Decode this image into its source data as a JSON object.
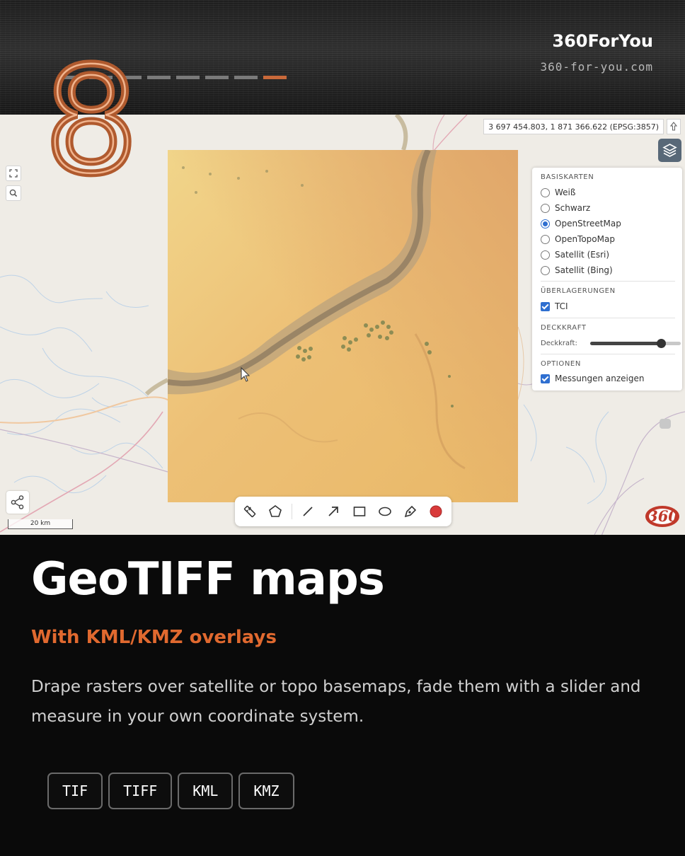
{
  "header": {
    "brand": "360ForYou",
    "url": "360-for-you.com",
    "slide_number": "8",
    "progress": {
      "total": 8,
      "current": 8
    },
    "accent_color": "#c9693a"
  },
  "map": {
    "coordinates": "3 697 454.803, 1 871 366.622 (EPSG:3857)",
    "coord_button_icon": "arrow-up-icon",
    "scale_label": "20 km",
    "layer_panel": {
      "basemaps_title": "BASISKARTEN",
      "basemaps": [
        {
          "label": "Weiß",
          "selected": false
        },
        {
          "label": "Schwarz",
          "selected": false
        },
        {
          "label": "OpenStreetMap",
          "selected": true
        },
        {
          "label": "OpenTopoMap",
          "selected": false
        },
        {
          "label": "Satellit (Esri)",
          "selected": false
        },
        {
          "label": "Satellit (Bing)",
          "selected": false
        }
      ],
      "overlays_title": "ÜBERLAGERUNGEN",
      "overlays": [
        {
          "label": "TCI",
          "checked": true
        }
      ],
      "opacity_title": "DECKKRAFT",
      "opacity_label": "Deckkraft:",
      "opacity_value": 0.78,
      "options_title": "OPTIONEN",
      "options": [
        {
          "label": "Messungen anzeigen",
          "checked": true
        }
      ]
    },
    "toolbar_tools": [
      "ruler-icon",
      "polygon-icon",
      "line-icon",
      "arrow-icon",
      "rectangle-icon",
      "ellipse-icon",
      "pen-icon",
      "color-icon"
    ],
    "draw_color": "#d93a3a",
    "watermark": "360"
  },
  "content": {
    "title": "GeoTIFF maps",
    "subtitle": "With KML/KMZ overlays",
    "description": "Drape rasters over satellite or topo basemaps, fade them with a slider and measure in your own coordinate system.",
    "formats": [
      "TIF",
      "TIFF",
      "KML",
      "KMZ"
    ],
    "subtitle_color": "#e0692f"
  }
}
